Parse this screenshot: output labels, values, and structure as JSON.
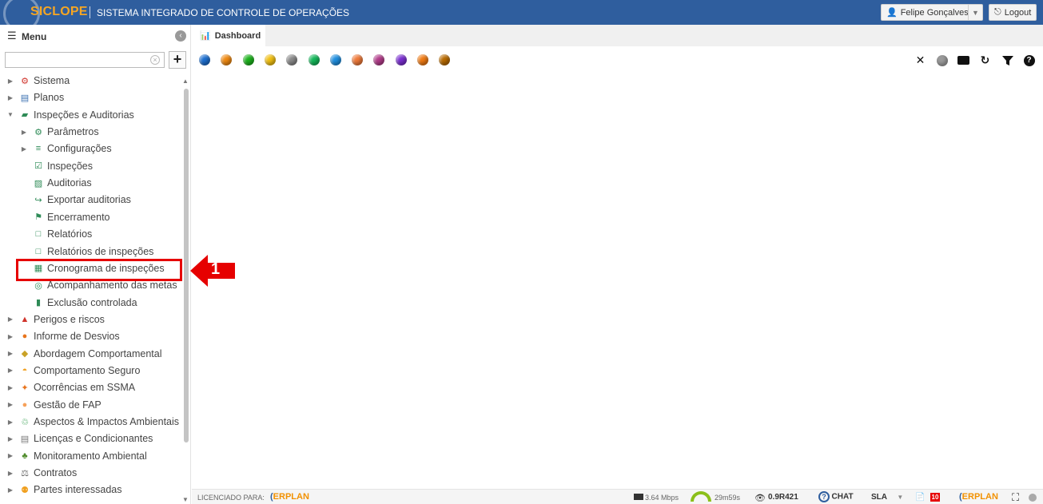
{
  "header": {
    "logo_text": "SICLOPE",
    "system_title": "SISTEMA INTEGRADO DE CONTROLE DE OPERAÇÕES",
    "user_name": "Felipe Gonçalves",
    "logout_label": "Logout"
  },
  "sidebar": {
    "title": "Menu",
    "search_placeholder": "",
    "items": [
      {
        "label": "Sistema",
        "level": 0,
        "expandable": true,
        "expanded": false,
        "icon": "gear-icon"
      },
      {
        "label": "Planos",
        "level": 0,
        "expandable": true,
        "expanded": false,
        "icon": "plan-icon"
      },
      {
        "label": "Inspeções e Auditorias",
        "level": 0,
        "expandable": true,
        "expanded": true,
        "icon": "folder-icon"
      },
      {
        "label": "Parâmetros",
        "level": 1,
        "expandable": true,
        "expanded": false,
        "icon": "cog-icon"
      },
      {
        "label": "Configurações",
        "level": 1,
        "expandable": true,
        "expanded": false,
        "icon": "sliders-icon"
      },
      {
        "label": "Inspeções",
        "level": 1,
        "expandable": false,
        "icon": "clipboard-check-icon"
      },
      {
        "label": "Auditorias",
        "level": 1,
        "expandable": false,
        "icon": "audit-icon"
      },
      {
        "label": "Exportar auditorias",
        "level": 1,
        "expandable": false,
        "icon": "export-icon"
      },
      {
        "label": "Encerramento",
        "level": 1,
        "expandable": false,
        "icon": "flag-icon"
      },
      {
        "label": "Relatórios",
        "level": 1,
        "expandable": false,
        "icon": "pdf-icon"
      },
      {
        "label": "Relatórios de inspeções",
        "level": 1,
        "expandable": false,
        "icon": "pdf-icon"
      },
      {
        "label": "Cronograma de inspeções",
        "level": 1,
        "expandable": false,
        "icon": "calendar-icon"
      },
      {
        "label": "Acompanhamento das metas",
        "level": 1,
        "expandable": false,
        "icon": "target-icon"
      },
      {
        "label": "Exclusão controlada",
        "level": 1,
        "expandable": false,
        "icon": "trash-icon"
      },
      {
        "label": "Perigos e riscos",
        "level": 0,
        "expandable": true,
        "expanded": false,
        "icon": "warning-icon"
      },
      {
        "label": "Informe de Desvios",
        "level": 0,
        "expandable": true,
        "expanded": false,
        "icon": "phone-icon"
      },
      {
        "label": "Abordagem Comportamental",
        "level": 0,
        "expandable": true,
        "expanded": false,
        "icon": "diamond-icon"
      },
      {
        "label": "Comportamento Seguro",
        "level": 0,
        "expandable": true,
        "expanded": false,
        "icon": "helmet-icon"
      },
      {
        "label": "Ocorrências em SSMA",
        "level": 0,
        "expandable": true,
        "expanded": false,
        "icon": "fall-icon"
      },
      {
        "label": "Gestão de FAP",
        "level": 0,
        "expandable": true,
        "expanded": false,
        "icon": "fap-icon"
      },
      {
        "label": "Aspectos & Impactos Ambientais",
        "level": 0,
        "expandable": true,
        "expanded": false,
        "icon": "recycle-icon"
      },
      {
        "label": "Licenças e Condicionantes",
        "level": 0,
        "expandable": true,
        "expanded": false,
        "icon": "license-icon"
      },
      {
        "label": "Monitoramento Ambiental",
        "level": 0,
        "expandable": true,
        "expanded": false,
        "icon": "tree-icon"
      },
      {
        "label": "Contratos",
        "level": 0,
        "expandable": true,
        "expanded": false,
        "icon": "scale-icon"
      },
      {
        "label": "Partes interessadas",
        "level": 0,
        "expandable": true,
        "expanded": false,
        "icon": "people-icon"
      }
    ]
  },
  "annotation": {
    "callout_number": "1"
  },
  "main": {
    "tab_label": "Dashboard",
    "status_balls": [
      "#1d6fd0",
      "#f08a12",
      "#1db31d",
      "#f2c012",
      "#8a8a8a",
      "#14b85a",
      "#1f8fe0",
      "#f07a3a",
      "#b23c8a",
      "#7a2fd0",
      "#f07a12",
      "#b86a00"
    ]
  },
  "footer": {
    "licensed_label": "LICENCIADO PARA:",
    "erplan_left": "ERPLAN",
    "speed": "3.64 Mbps",
    "session_time": "29m59s",
    "version": "0.9R421",
    "chat_label": "CHAT",
    "sla_label": "SLA",
    "badge_count": "10",
    "erplan_right": "ERPLAN"
  },
  "colors": {
    "header_bg": "#2f5e9e",
    "logo_accent": "#f6a623",
    "highlight": "#e60000"
  }
}
